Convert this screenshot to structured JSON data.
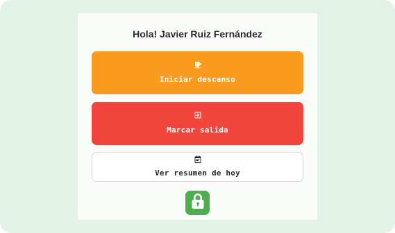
{
  "greeting": "Hola! Javier Ruiz Fernández",
  "actions": {
    "break": {
      "label": "Iniciar descanso",
      "icon": "coffee-icon",
      "color": "#fa9a1f"
    },
    "exit": {
      "label": "Marcar salida",
      "icon": "logout-icon",
      "color": "#f1453d"
    },
    "summary": {
      "label": "Ver resumen de hoy",
      "icon": "calendar-icon",
      "color": "#ffffff"
    }
  },
  "lock": {
    "icon": "lock-icon",
    "color": "#4cae4f"
  },
  "colors": {
    "background": "#e3f2e6",
    "card": "#fafcfa",
    "text": "#2b2b2b"
  }
}
